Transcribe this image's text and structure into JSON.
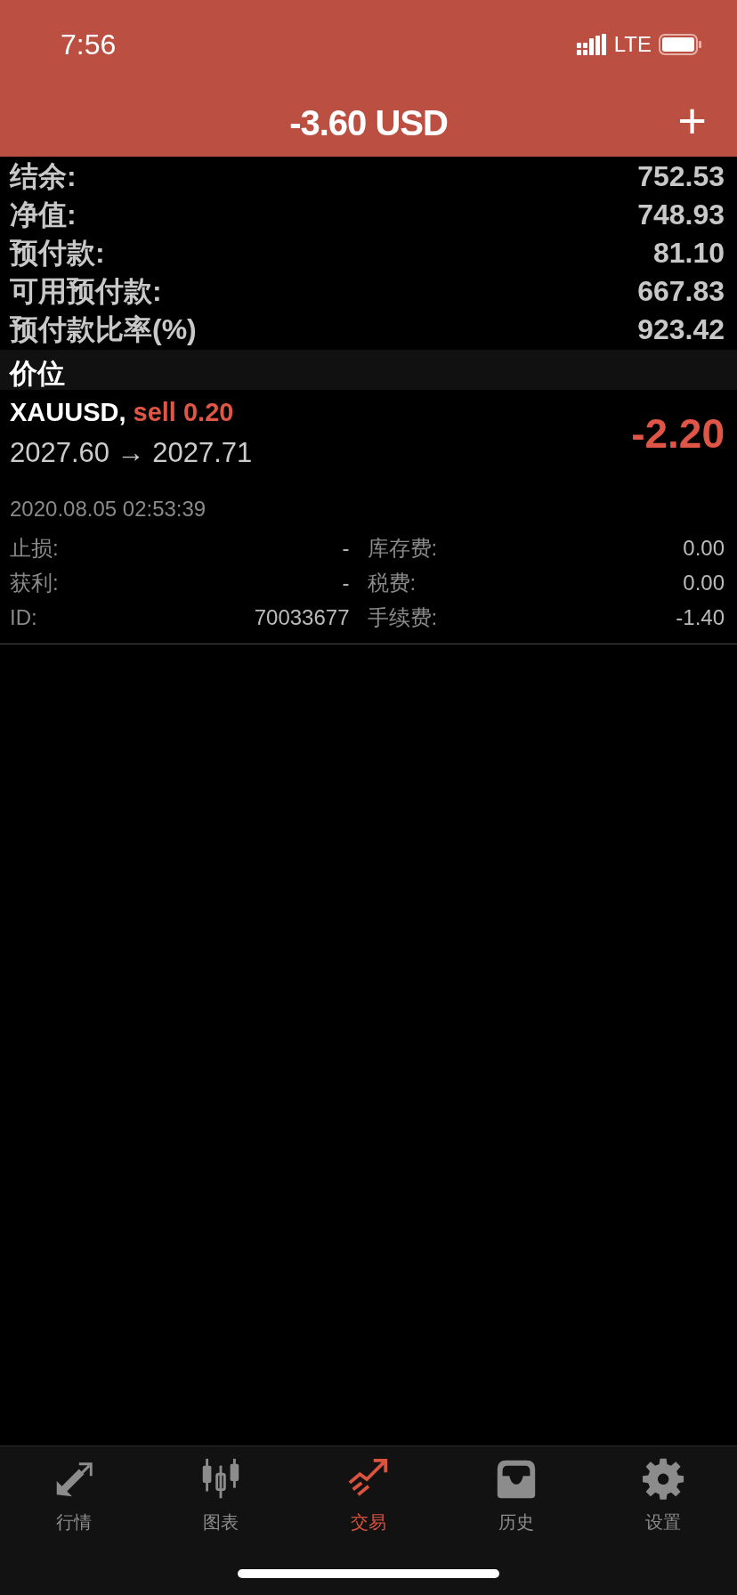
{
  "status_bar": {
    "time": "7:56",
    "network": "LTE"
  },
  "header": {
    "title": "-3.60 USD",
    "add_button": "+"
  },
  "summary": [
    {
      "label": "结余:",
      "value": "752.53"
    },
    {
      "label": "净值:",
      "value": "748.93"
    },
    {
      "label": "预付款:",
      "value": "81.10"
    },
    {
      "label": "可用预付款:",
      "value": "667.83"
    },
    {
      "label": "预付款比率(%)",
      "value": "923.42"
    }
  ],
  "positions_header": "价位",
  "positions": [
    {
      "symbol": "XAUUSD,",
      "order": "sell 0.20",
      "prices": "2027.60 → 2027.71",
      "profit": "-2.20",
      "time": "2020.08.05 02:53:39",
      "details": [
        {
          "label": "止损:",
          "value": "-",
          "label2": "库存费:",
          "value2": "0.00"
        },
        {
          "label": "获利:",
          "value": "-",
          "label2": "税费:",
          "value2": "0.00"
        },
        {
          "label": "ID:",
          "value": "70033677",
          "label2": "手续费:",
          "value2": "-1.40"
        }
      ]
    }
  ],
  "tabs": [
    {
      "label": "行情",
      "kind": "arrows",
      "selected": false
    },
    {
      "label": "图表",
      "kind": "candles",
      "selected": false
    },
    {
      "label": "交易",
      "kind": "trend",
      "selected": true
    },
    {
      "label": "历史",
      "kind": "inbox",
      "selected": false
    },
    {
      "label": "设置",
      "kind": "gear",
      "selected": false
    }
  ]
}
